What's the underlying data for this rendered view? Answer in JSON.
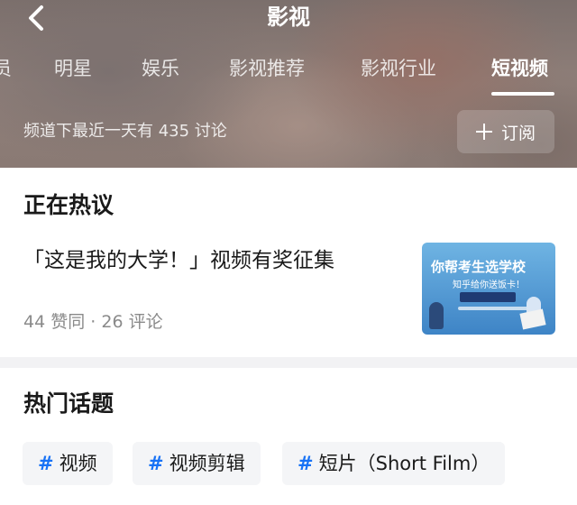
{
  "header": {
    "title": "影视",
    "tabs": [
      {
        "label": "员"
      },
      {
        "label": "明星"
      },
      {
        "label": "娱乐"
      },
      {
        "label": "影视推荐"
      },
      {
        "label": "影视行业"
      },
      {
        "label": "短视频",
        "active": true
      }
    ],
    "subtitle": "频道下最近一天有 435 讨论",
    "subscribe_label": "订阅"
  },
  "hot": {
    "section_title": "正在热议",
    "headline": "「这是我的大学！」视频有奖征集",
    "likes": "44 赞同",
    "separator": "·",
    "comments": "26 评论",
    "thumbnail": {
      "title": "你帮考生选学校",
      "subtitle": "知乎给你送饭卡！",
      "icon": "campaign-poster"
    }
  },
  "topics": {
    "section_title": "热门话题",
    "chips": [
      {
        "hash": "#",
        "label": "视频"
      },
      {
        "hash": "#",
        "label": "视频剪辑"
      },
      {
        "hash": "#",
        "label": "短片（Short Film）"
      }
    ]
  },
  "colors": {
    "accent": "#1772f6",
    "text_primary": "#1a1a1a",
    "text_secondary": "#8a8a8a",
    "chip_bg": "#f4f5f7"
  }
}
